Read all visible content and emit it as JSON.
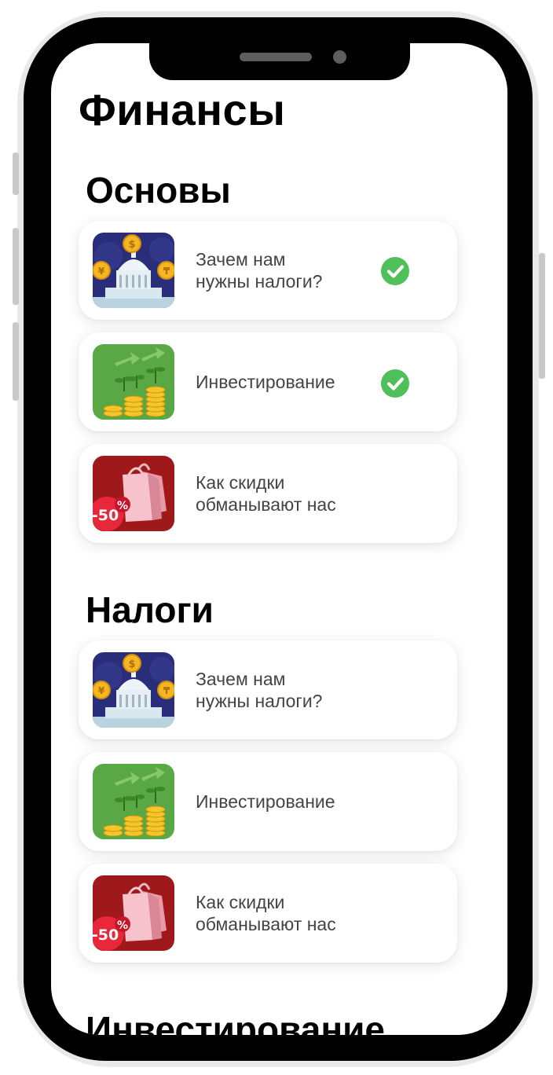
{
  "page": {
    "title": "Финансы"
  },
  "sections": [
    {
      "title": "Основы",
      "items": [
        {
          "label": "Зачем нам\nнужны налоги?",
          "image": "taxes-image",
          "completed": true
        },
        {
          "label": "Инвестирование",
          "image": "investing-image",
          "completed": true
        },
        {
          "label": "Как скидки\nобманывают нас",
          "image": "discount-image",
          "completed": false
        }
      ]
    },
    {
      "title": "Налоги",
      "items": [
        {
          "label": "Зачем нам\nнужны налоги?",
          "image": "taxes-image",
          "completed": false
        },
        {
          "label": "Инвестирование",
          "image": "investing-image",
          "completed": false
        },
        {
          "label": "Как скидки\nобманывают нас",
          "image": "discount-image",
          "completed": false
        }
      ]
    },
    {
      "title": "Инвестирование",
      "items": []
    }
  ],
  "images": {
    "discount_badge": "-50",
    "percent_sign": "%",
    "coin_symbols": [
      "$",
      "¥",
      "₸"
    ]
  },
  "colors": {
    "check_green": "#4fbf5a",
    "taxes_bg": "#2a2d7a",
    "investing_bg": "#5aa845",
    "discount_bg": "#a0191a"
  }
}
